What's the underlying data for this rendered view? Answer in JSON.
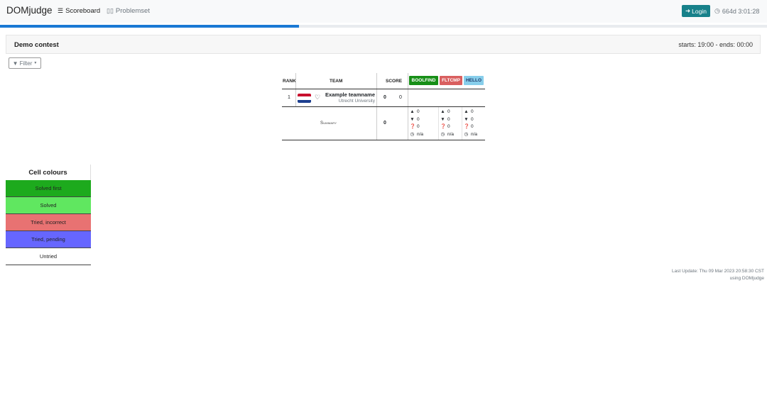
{
  "navbar": {
    "brand": "DOMjudge",
    "scoreboard_icon": "list-icon",
    "scoreboard_label": "Scoreboard",
    "problemset_icon": "book-icon",
    "problemset_label": "Problemset",
    "login_icon": "sign-in-icon",
    "login_label": "Login",
    "clock_icon": "clock-icon",
    "countdown": "664d 3:01:28"
  },
  "progress": {
    "fraction": 0.39,
    "color": "#1a79d4"
  },
  "contest": {
    "name": "Demo contest",
    "times": "starts: 19:00 - ends: 00:00"
  },
  "filter": {
    "icon": "filter-icon",
    "label": "Filter"
  },
  "scoreboard": {
    "headers": {
      "rank": "RANK",
      "team": "TEAM",
      "score": "SCORE"
    },
    "problems": [
      {
        "label": "BOOLFIND",
        "color": "#178f17"
      },
      {
        "label": "FLTCMP",
        "color": "#d95f5f"
      },
      {
        "label": "HELLO",
        "color": "#87ceeb"
      }
    ],
    "teams": [
      {
        "rank": "1",
        "flag_icon": "netherlands-flag-icon",
        "favorite_icon": "heart-outline-icon",
        "name": "Example teamname",
        "affiliation": "Utrecht University",
        "points": "0",
        "time": "0"
      }
    ],
    "summary": {
      "label": "Summary",
      "score": "0",
      "problems": [
        {
          "correct": "0",
          "incorrect": "0",
          "pending": "0",
          "first": "n/a"
        },
        {
          "correct": "0",
          "incorrect": "0",
          "pending": "0",
          "first": "n/a"
        },
        {
          "correct": "0",
          "incorrect": "0",
          "pending": "0",
          "first": "n/a"
        }
      ]
    }
  },
  "legend": {
    "title": "Cell colours",
    "items": [
      {
        "label": "Solved first",
        "color": "#1daa1d"
      },
      {
        "label": "Solved",
        "color": "#60e760"
      },
      {
        "label": "Tried, incorrect",
        "color": "#e87272"
      },
      {
        "label": "Tried, pending",
        "color": "#6666ff"
      },
      {
        "label": "Untried",
        "color": "#ffffff"
      }
    ]
  },
  "footer": {
    "last_update": "Last Update: Thu 09 Mar 2023 20:58:30 CST",
    "using": "using DOMjudge"
  }
}
